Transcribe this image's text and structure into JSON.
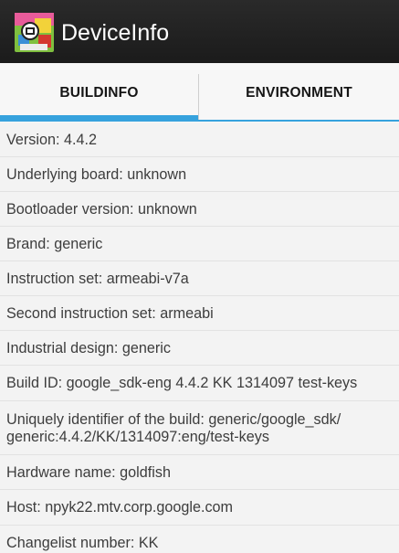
{
  "app": {
    "title": "DeviceInfo",
    "icon": "device-info-app-icon"
  },
  "tabs": [
    {
      "label": "BUILDINFO",
      "selected": true
    },
    {
      "label": "ENVIRONMENT",
      "selected": false
    }
  ],
  "colors": {
    "action_bar": "#1f1f1f",
    "accent": "#36a2dd",
    "list_bg": "#f3f3f3",
    "text": "#3d3d3d"
  },
  "rows": [
    "Version: 4.4.2",
    "Underlying board: unknown",
    "Bootloader version: unknown",
    "Brand: generic",
    "Instruction set: armeabi-v7a",
    "Second instruction set: armeabi",
    "Industrial design: generic",
    "Build ID: google_sdk-eng 4.4.2 KK 1314097 test-keys",
    "Uniquely identifier of the build: generic/google_sdk/\ngeneric:4.4.2/KK/1314097:eng/test-keys",
    "Hardware name: goldfish",
    "Host: npyk22.mtv.corp.google.com",
    "Changelist number: KK"
  ]
}
